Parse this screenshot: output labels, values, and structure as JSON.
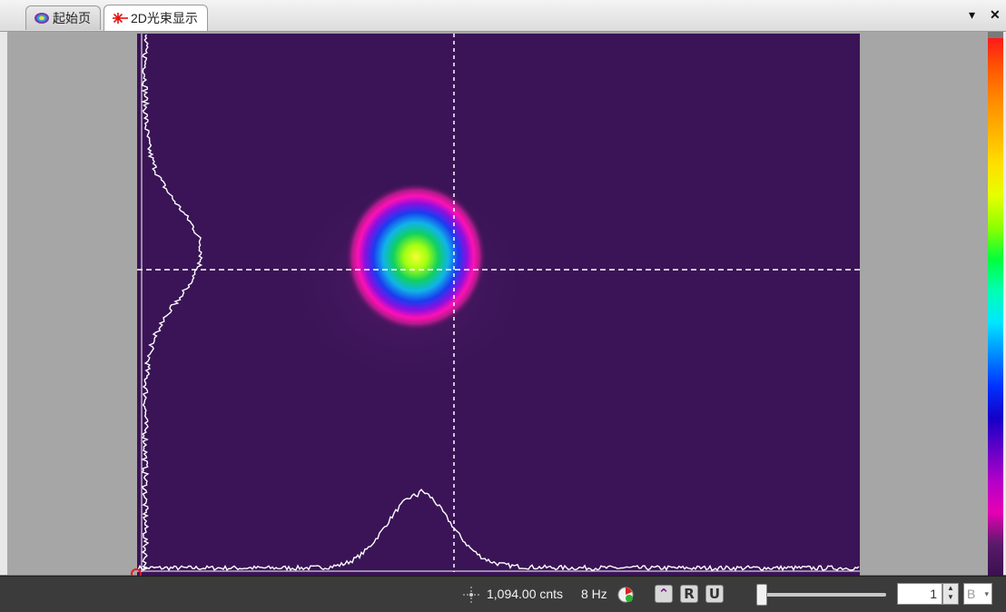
{
  "tabs": [
    {
      "label": "起始页",
      "icon": "start-page-icon"
    },
    {
      "label": "2D光束显示",
      "icon": "laser-burst-icon",
      "active": true
    }
  ],
  "window_controls": {
    "dropdown_icon": "chevron-down-icon",
    "close_icon": "close-icon"
  },
  "palette_colors": [
    "#ff1a1a",
    "#ff5a00",
    "#ff8c00",
    "#ffb400",
    "#ffe000",
    "#e6ff00",
    "#8cff00",
    "#00ff3c",
    "#00ffb4",
    "#00e6ff",
    "#008cff",
    "#0032ff",
    "#1400c8",
    "#6400c8",
    "#b400c8",
    "#e600b4",
    "#5a1a6a",
    "#3a1050"
  ],
  "beam": {
    "background_color": "#3a1456",
    "crosshair_color": "#ffffff",
    "profile_color": "#ffffff"
  },
  "status": {
    "counts": "1,094.00 cnts",
    "rate": "8 Hz",
    "spin_value": "1",
    "unit_label": "B"
  },
  "status_icons": [
    "crosshair-move-icon",
    "capture-status-icon",
    "top-view-icon",
    "r-icon",
    "u-icon"
  ]
}
